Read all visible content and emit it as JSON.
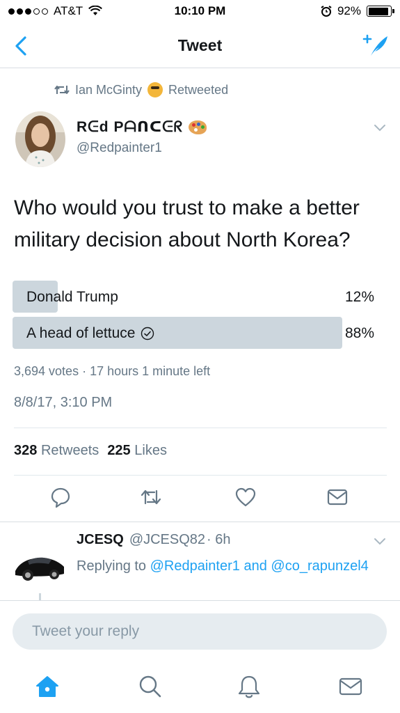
{
  "status_bar": {
    "carrier": "AT&T",
    "time": "10:10 PM",
    "battery": "92%",
    "battery_level": 0.92
  },
  "nav": {
    "title": "Tweet"
  },
  "retweet_context": {
    "retweeter": "Ian McGinty",
    "label": "Retweeted"
  },
  "author": {
    "display_name": "Rᕮd Pᗩᑎᑕᕮᖇ",
    "handle": "@Redpainter1"
  },
  "tweet": {
    "text": "Who would you trust to make a better military decision about North Korea?"
  },
  "poll": {
    "options": [
      {
        "label": "Donald Trump",
        "percent": "12%",
        "value": 12,
        "winner": false
      },
      {
        "label": "A head of lettuce",
        "percent": "88%",
        "value": 88,
        "winner": true
      }
    ],
    "meta": "3,694 votes · 17 hours 1 minute left"
  },
  "timestamp": "8/8/17, 3:10 PM",
  "counts": {
    "retweets_number": "328",
    "retweets_label": "Retweets",
    "likes_number": "225",
    "likes_label": "Likes"
  },
  "reply": {
    "name": "JCESQ",
    "handle": "@JCESQ82",
    "time": "· 6h",
    "replying_prefix": "Replying to",
    "mention1": "@Redpainter1",
    "conjunction": "and",
    "mention2": "@co_rapunzel4"
  },
  "reply_box": {
    "placeholder": "Tweet your reply"
  },
  "colors": {
    "accent": "#1da1f2",
    "secondary_text": "#657786",
    "poll_bar": "#ccd6dd"
  },
  "icons": {
    "back": "chevron-left-icon",
    "compose": "compose-tweet-icon",
    "retweet": "retweet-icon",
    "reply": "reply-icon",
    "like": "heart-icon",
    "message": "envelope-icon",
    "home": "home-icon",
    "search": "search-icon",
    "notifications": "bell-icon"
  }
}
